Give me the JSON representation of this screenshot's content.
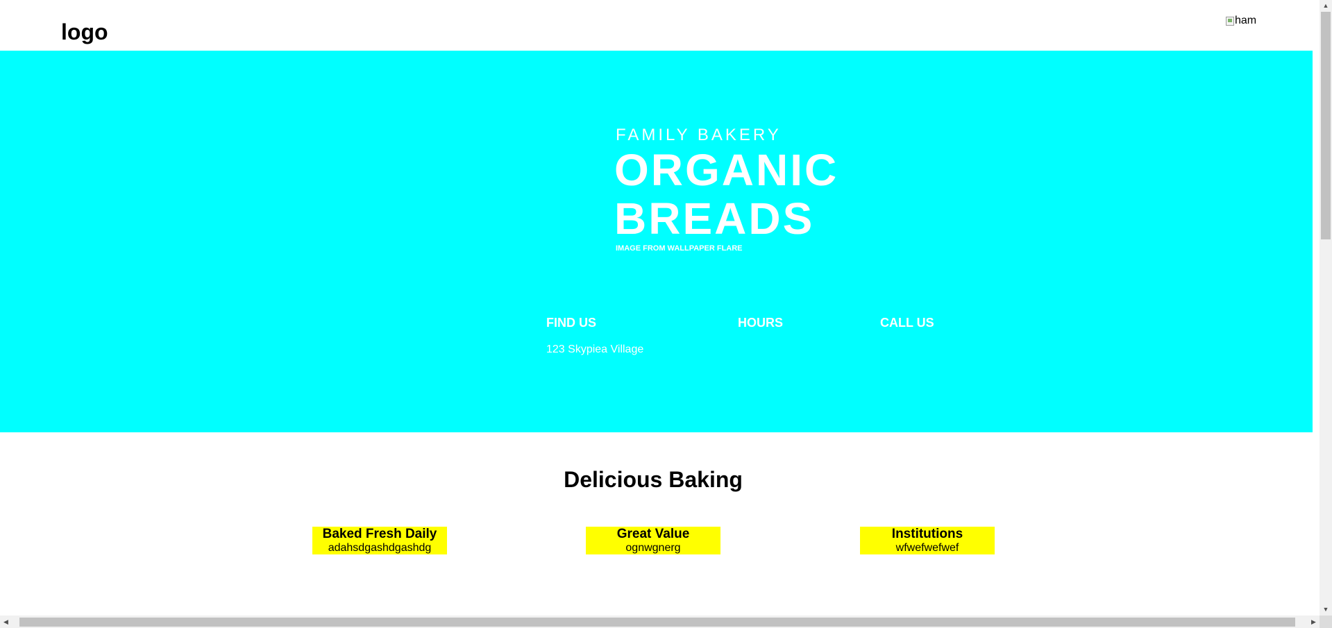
{
  "header": {
    "logo_text": "logo",
    "menu_image_alt": "ham"
  },
  "hero": {
    "subtitle": "FAMILY BAKERY",
    "title_line1": "ORGANIC",
    "title_line2": "BREADS",
    "credit": "IMAGE FROM WALLPAPER FLARE",
    "background_color": "#00ffff",
    "info": [
      {
        "heading": "FIND US",
        "text": "123 Skypiea Village"
      },
      {
        "heading": "HOURS",
        "text": ""
      },
      {
        "heading": "CALL US",
        "text": ""
      }
    ]
  },
  "features": {
    "title": "Delicious Baking",
    "card_color": "#ffff00",
    "cards": [
      {
        "title": "Baked Fresh Daily",
        "text": "adahsdgashdgashdg"
      },
      {
        "title": "Great Value",
        "text": "ognwgnerg"
      },
      {
        "title": "Institutions",
        "text": "wfwefwefwef"
      }
    ]
  },
  "scrollbars": {
    "up_arrow": "▲",
    "down_arrow": "▼",
    "left_arrow": "◀",
    "right_arrow": "▶"
  }
}
